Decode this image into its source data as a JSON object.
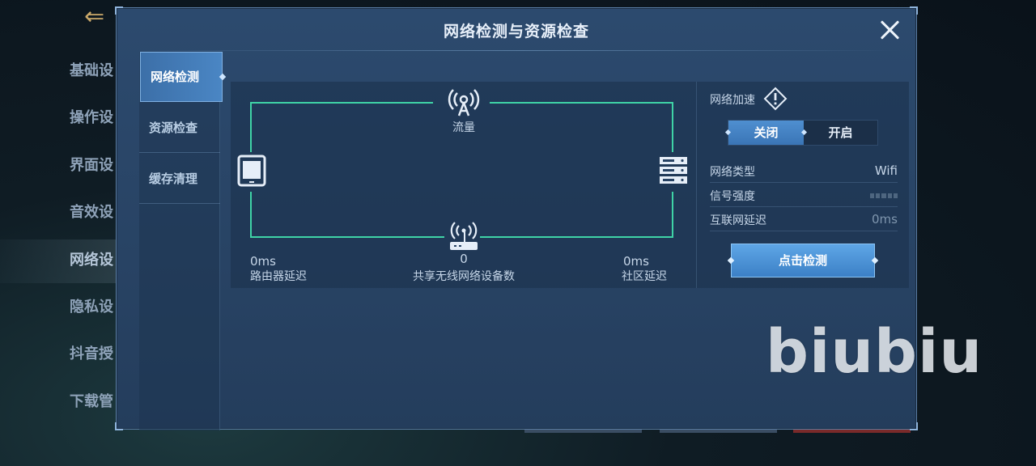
{
  "background_menu": {
    "items": [
      "基础设",
      "操作设",
      "界面设",
      "音效设",
      "网络设",
      "隐私设",
      "抖音授",
      "下载管"
    ],
    "active_index": 4
  },
  "dialog": {
    "title": "网络检测与资源检查",
    "tabs": [
      {
        "label": "网络检测",
        "active": true
      },
      {
        "label": "资源检查",
        "active": false
      },
      {
        "label": "缓存清理",
        "active": false
      }
    ],
    "diagram": {
      "top_node_label": "流量",
      "router_value": "0ms",
      "router_label": "路由器延迟",
      "shared_value": "0",
      "shared_label": "共享无线网络设备数",
      "community_value": "0ms",
      "community_label": "社区延迟"
    },
    "side": {
      "accel_label": "网络加速",
      "toggle_off": "关闭",
      "toggle_on": "开启",
      "toggle_selected": "关闭",
      "rows": [
        {
          "key": "网络类型",
          "value": "Wifi"
        },
        {
          "key": "信号强度",
          "value": ""
        },
        {
          "key": "互联网延迟",
          "value": "0ms"
        }
      ],
      "detect_button": "点击检测"
    }
  },
  "watermark": "biubiu",
  "colors": {
    "accent_line": "#3fd3a6",
    "active_blue": "#4a86c4",
    "panel_bg": "#2c4a6e"
  }
}
